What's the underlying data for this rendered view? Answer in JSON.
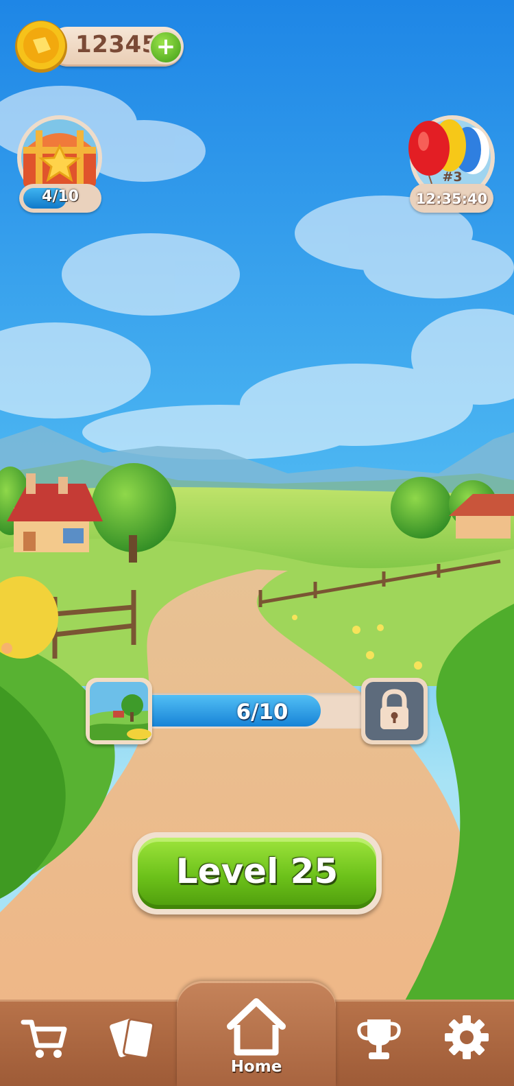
{
  "hud": {
    "coins": "12345",
    "add_coins": "+",
    "chest_progress": "4/10",
    "chest_progress_fraction": 0.4,
    "event_rank": "#3",
    "event_timer": "12:35:40"
  },
  "area_progress": {
    "text": "6/10",
    "fraction": 0.6
  },
  "play": {
    "label": "Level 25"
  },
  "nav": {
    "items": [
      {
        "name": "shop",
        "icon": "cart-icon"
      },
      {
        "name": "cards",
        "icon": "cards-icon"
      },
      {
        "name": "home",
        "icon": "home-icon",
        "label": "Home",
        "active": true
      },
      {
        "name": "trophy",
        "icon": "trophy-icon"
      },
      {
        "name": "settings",
        "icon": "gear-icon"
      }
    ],
    "home_label": "Home"
  },
  "colors": {
    "play_button": "#6cc11a",
    "progress_fill": "#1783d6",
    "navbar": "#a8643f"
  }
}
